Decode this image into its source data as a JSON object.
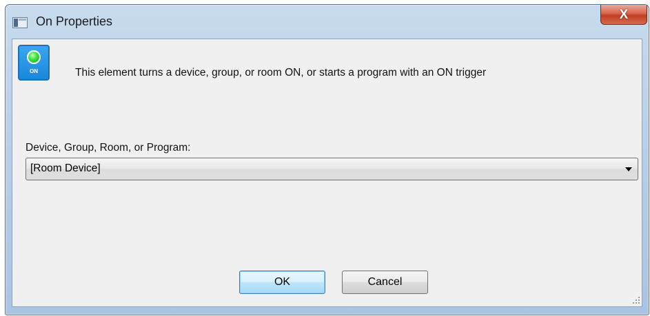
{
  "window": {
    "title": "On Properties",
    "close_label": "X"
  },
  "element_icon": {
    "icon": "on-trigger-icon",
    "label": "ON",
    "led_color": "#36e23d",
    "background_color": "#1b87da"
  },
  "description": "This element turns a device, group, or room ON, or starts a program with an ON trigger",
  "target_field": {
    "label": "Device, Group, Room, or Program:",
    "selected_value": "[Room Device]"
  },
  "buttons": {
    "ok_label": "OK",
    "cancel_label": "Cancel"
  }
}
